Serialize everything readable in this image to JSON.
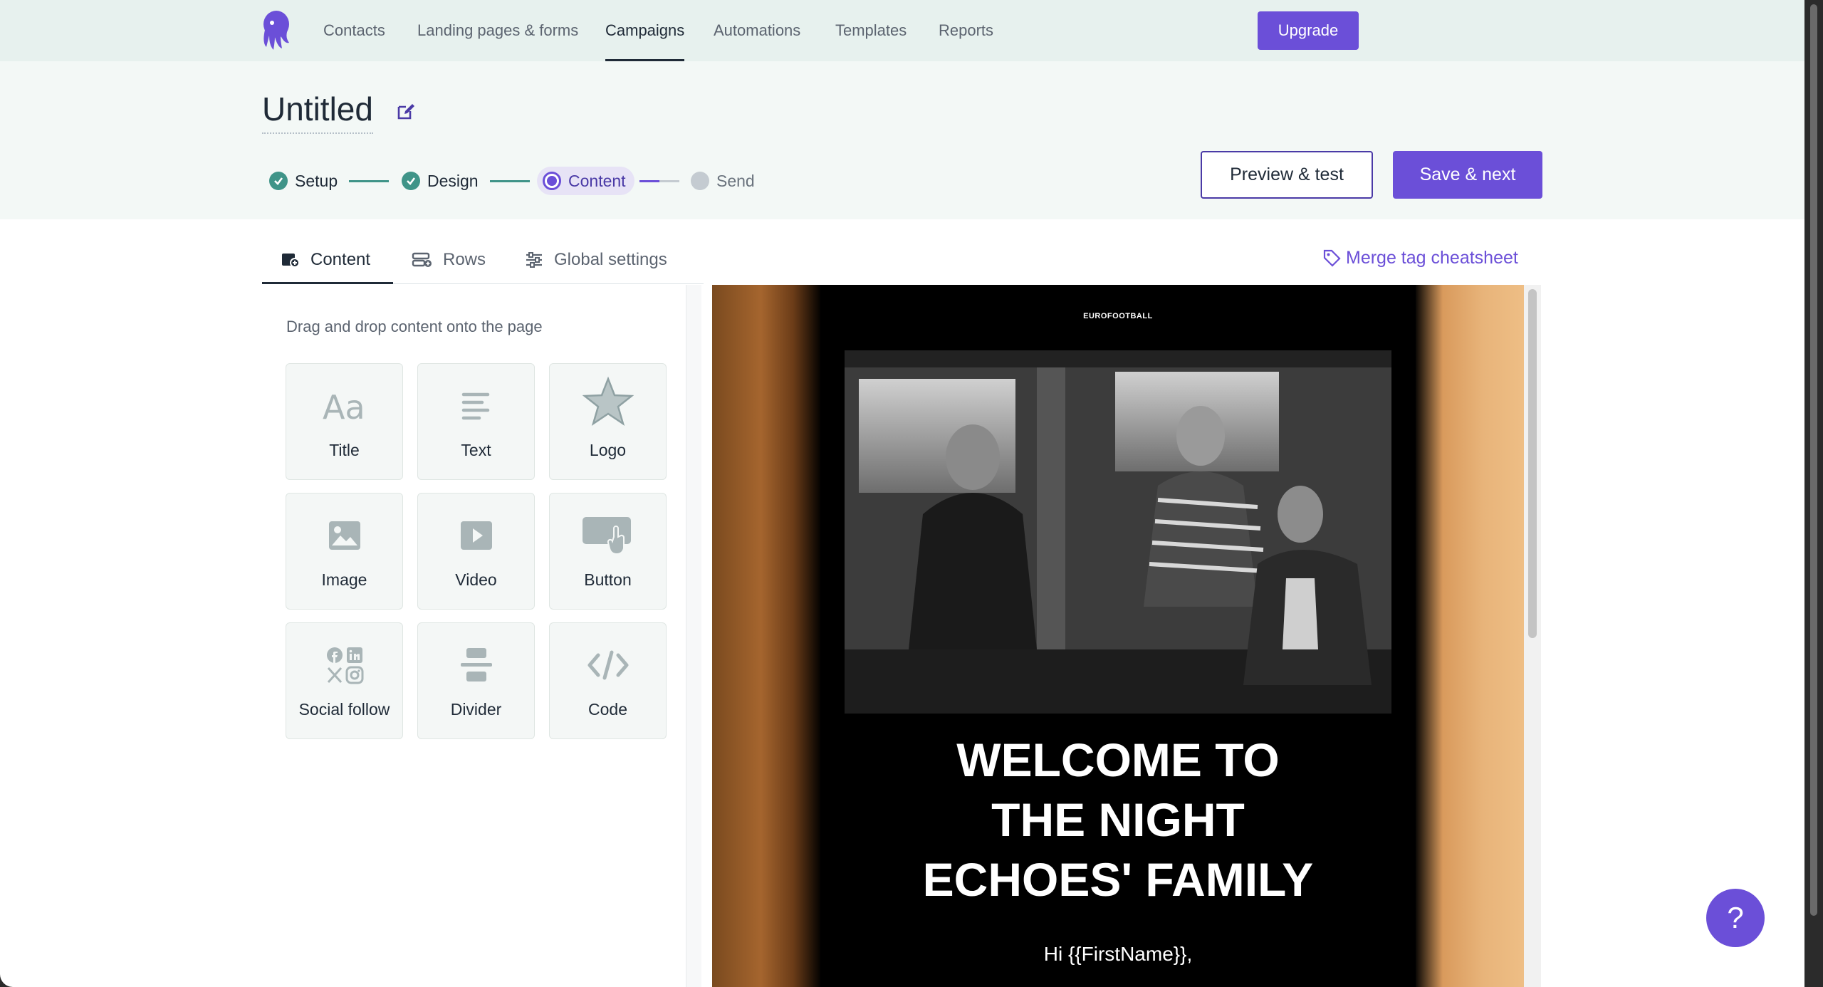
{
  "nav": {
    "items": [
      "Contacts",
      "Landing pages & forms",
      "Campaigns",
      "Automations",
      "Templates",
      "Reports"
    ],
    "active": "Campaigns",
    "upgrade_label": "Upgrade"
  },
  "header": {
    "title": "Untitled",
    "steps": [
      {
        "label": "Setup",
        "state": "done"
      },
      {
        "label": "Design",
        "state": "done"
      },
      {
        "label": "Content",
        "state": "current"
      },
      {
        "label": "Send",
        "state": "todo"
      }
    ],
    "preview_label": "Preview & test",
    "save_label": "Save & next"
  },
  "editor": {
    "tabs": [
      "Content",
      "Rows",
      "Global settings"
    ],
    "active_tab": "Content",
    "merge_label": "Merge tag cheatsheet"
  },
  "panel": {
    "hint": "Drag and drop content onto the page",
    "blocks": [
      {
        "label": "Title",
        "icon": "title-icon"
      },
      {
        "label": "Text",
        "icon": "text-icon"
      },
      {
        "label": "Logo",
        "icon": "star-icon"
      },
      {
        "label": "Image",
        "icon": "image-icon"
      },
      {
        "label": "Video",
        "icon": "video-icon"
      },
      {
        "label": "Button",
        "icon": "button-icon"
      },
      {
        "label": "Social follow",
        "icon": "social-icon"
      },
      {
        "label": "Divider",
        "icon": "divider-icon"
      },
      {
        "label": "Code",
        "icon": "code-icon"
      }
    ]
  },
  "email": {
    "brand": "EUROFOOTBALL",
    "headline_lines": [
      "WELCOME TO",
      "THE NIGHT",
      "ECHOES' FAMILY"
    ],
    "greeting": "Hi {{FirstName}},"
  },
  "help": {
    "label": "?"
  },
  "colors": {
    "accent": "#6b4fd8",
    "done": "#3f9488",
    "nav_bg": "#e7f1ee",
    "header_bg": "#f3f8f6"
  }
}
